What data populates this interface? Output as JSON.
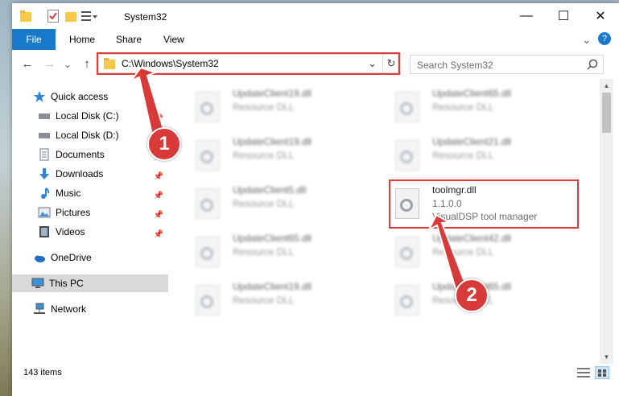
{
  "window": {
    "title": "System32"
  },
  "controls": {
    "minimize": "—",
    "maximize": "☐",
    "close": "✕"
  },
  "ribbon": {
    "tabs": [
      "File",
      "Home",
      "Share",
      "View"
    ],
    "expand": "⌄",
    "help": "?"
  },
  "nav_buttons": {
    "back": "←",
    "forward": "→",
    "recent": "⌄",
    "up": "↑"
  },
  "address": {
    "path": "C:\\Windows\\System32",
    "dropdown": "⌄",
    "refresh": "↻"
  },
  "search": {
    "placeholder": "Search System32"
  },
  "navpane": {
    "items": [
      {
        "label": "Quick access",
        "icon": "star-icon",
        "pinned": false
      },
      {
        "label": "Local Disk (C:)",
        "icon": "drive-icon",
        "pinned": true
      },
      {
        "label": "Local Disk (D:)",
        "icon": "drive-icon",
        "pinned": false
      },
      {
        "label": "Documents",
        "icon": "documents-icon",
        "pinned": true
      },
      {
        "label": "Downloads",
        "icon": "download-icon",
        "pinned": true
      },
      {
        "label": "Music",
        "icon": "music-icon",
        "pinned": true
      },
      {
        "label": "Pictures",
        "icon": "pictures-icon",
        "pinned": true
      },
      {
        "label": "Videos",
        "icon": "videos-icon",
        "pinned": true
      },
      {
        "label": "OneDrive",
        "icon": "cloud-icon",
        "pinned": false
      },
      {
        "label": "This PC",
        "icon": "computer-icon",
        "pinned": false
      },
      {
        "label": "Network",
        "icon": "network-icon",
        "pinned": false
      }
    ],
    "pin_glyph": "📌"
  },
  "files": [
    {
      "name": "UpdateClient19.dll",
      "type": "Resource DLL",
      "desc": ""
    },
    {
      "name": "UpdateClient65.dll",
      "type": "Resource DLL",
      "desc": ""
    },
    {
      "name": "UpdateClient19.dll",
      "type": "Resource DLL",
      "desc": ""
    },
    {
      "name": "UpdateClient21.dll",
      "type": "Resource DLL",
      "desc": ""
    },
    {
      "name": "UpdateClient5.dll",
      "type": "Resource DLL",
      "desc": ""
    },
    {
      "name": "toolmgr.dll",
      "type": "1.1.0.0",
      "desc": "VisualDSP tool manager"
    },
    {
      "name": "UpdateClient65.dll",
      "type": "Resource DLL",
      "desc": ""
    },
    {
      "name": "UpdateClient42.dll",
      "type": "Resource DLL",
      "desc": ""
    },
    {
      "name": "UpdateClient19.dll",
      "type": "Resource DLL",
      "desc": ""
    },
    {
      "name": "UpdateClient65.dll",
      "type": "Resource DLL",
      "desc": ""
    }
  ],
  "status": {
    "count": "143 items"
  },
  "callouts": {
    "one": "1",
    "two": "2"
  },
  "colors": {
    "accent": "#1979ca",
    "callout": "#d83a3a"
  }
}
